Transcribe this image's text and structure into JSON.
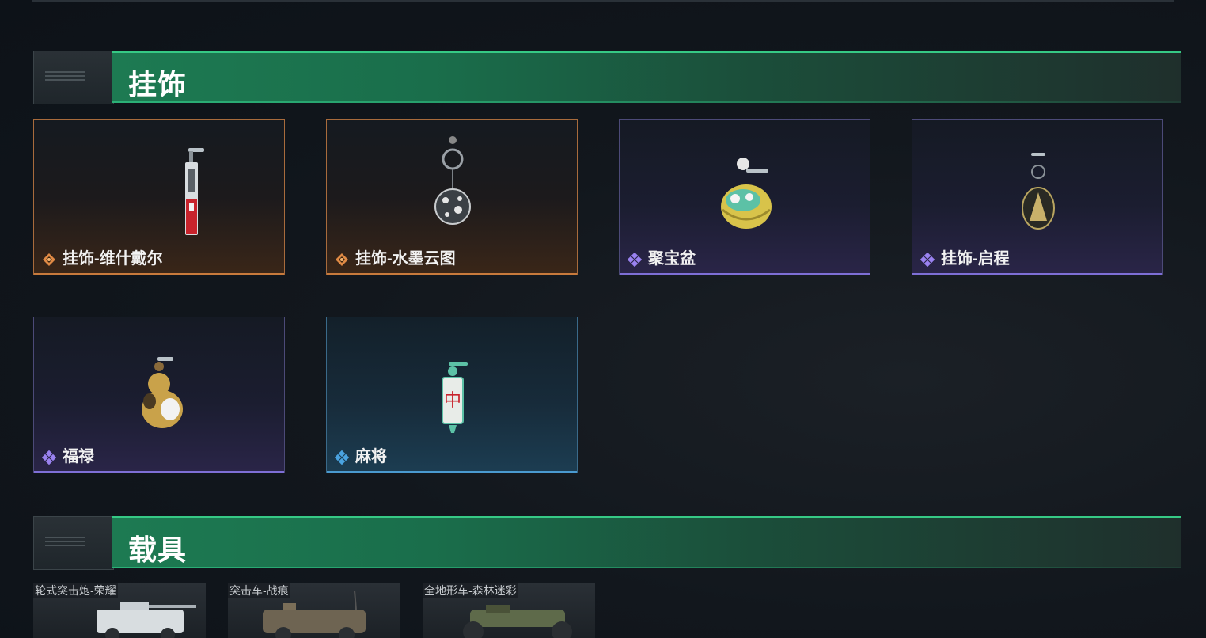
{
  "sections": {
    "charms": {
      "title": "挂饰"
    },
    "vehicles": {
      "title": "载具"
    }
  },
  "charms": [
    {
      "name": "挂饰-维什戴尔",
      "rarity": "gold",
      "icon": "red-blade-charm-icon"
    },
    {
      "name": "挂饰-水墨云图",
      "rarity": "gold",
      "icon": "ink-sphere-charm-icon"
    },
    {
      "name": "聚宝盆",
      "rarity": "purple",
      "icon": "treasure-bowl-charm-icon"
    },
    {
      "name": "挂饰-启程",
      "rarity": "purple",
      "icon": "medal-charm-icon"
    },
    {
      "name": "福禄",
      "rarity": "purple",
      "icon": "gourd-charm-icon"
    },
    {
      "name": "麻将",
      "rarity": "blue",
      "icon": "mahjong-tile-charm-icon"
    }
  ],
  "vehicles": [
    {
      "name": "轮式突击炮-荣耀"
    },
    {
      "name": "突击车-战痕"
    },
    {
      "name": "全地形车-森林迷彩"
    }
  ],
  "colors": {
    "gold": "#c87a3c",
    "purple": "#7e6fd6",
    "blue": "#4a9ad0",
    "section_green": "#1d7a52"
  }
}
